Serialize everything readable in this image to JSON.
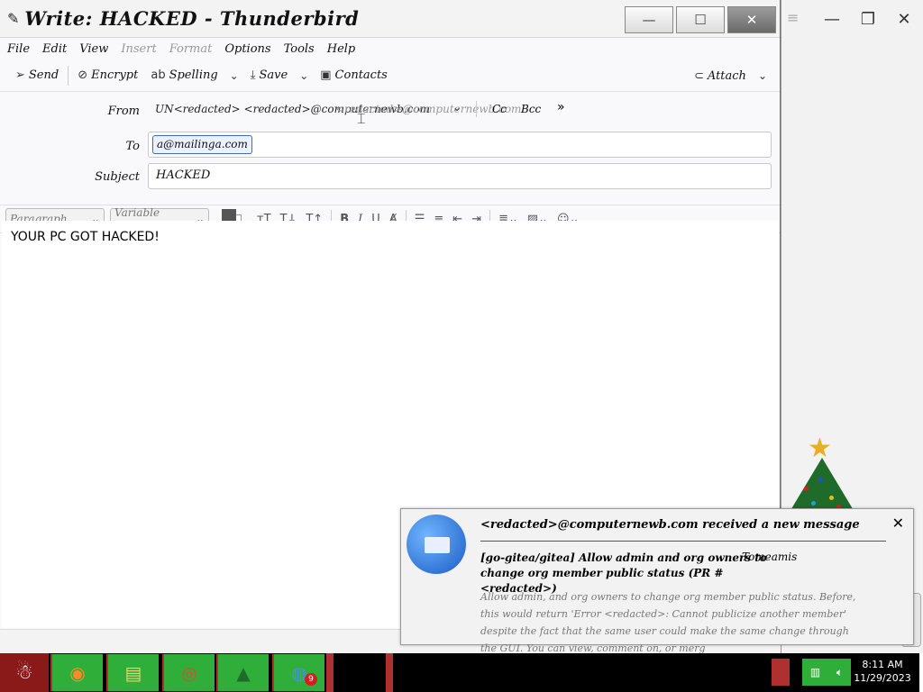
{
  "window": {
    "title": "Write: HACKED - Thunderbird",
    "minimize": "—",
    "maximize": "☐",
    "close": "✕"
  },
  "menu": [
    "File",
    "Edit",
    "View",
    "Insert",
    "Format",
    "Options",
    "Tools",
    "Help"
  ],
  "toolbar": {
    "send": "Send",
    "encrypt": "Encrypt",
    "spelling": "Spelling",
    "save": "Save",
    "contacts": "Contacts",
    "attach": "Attach"
  },
  "compose": {
    "from_label": "From",
    "from_value": "UN<redacted> <redacted>@computernewb.com",
    "from_alt": "<redacted>@computernewb.com",
    "cc": "Cc",
    "bcc": "Bcc",
    "more": "»",
    "to_label": "To",
    "to_value": "a@mailinga.com",
    "subject_label": "Subject",
    "subject_value": "HACKED"
  },
  "format": {
    "paragraph": "Paragraph",
    "font": "Variable Width"
  },
  "body_text": "YOUR PC GOT HACKED!",
  "notification": {
    "sender": "<redacted>@computernewb.com received a new message",
    "subject": "[go-gitea/gitea] Allow admin and org owners to change org member public status (PR #<redacted>)",
    "org": "Tomeamis",
    "body": "Allow admin, and org owners to change org member public status. Before, this would return 'Error <redacted>: Cannot publicize another member' despite the fact that the same user could make the same change through the GUI. You can view, comment on, or merg",
    "close": "✕"
  },
  "taskbar": {
    "badge": "9",
    "time": "8:11 AM",
    "date": "11/29/2023"
  },
  "colors": {
    "accent": "#3a6cc8",
    "taskbar_green": "#2fae3a",
    "taskbar_red": "#b03030",
    "start_red": "#8a1a1a"
  }
}
